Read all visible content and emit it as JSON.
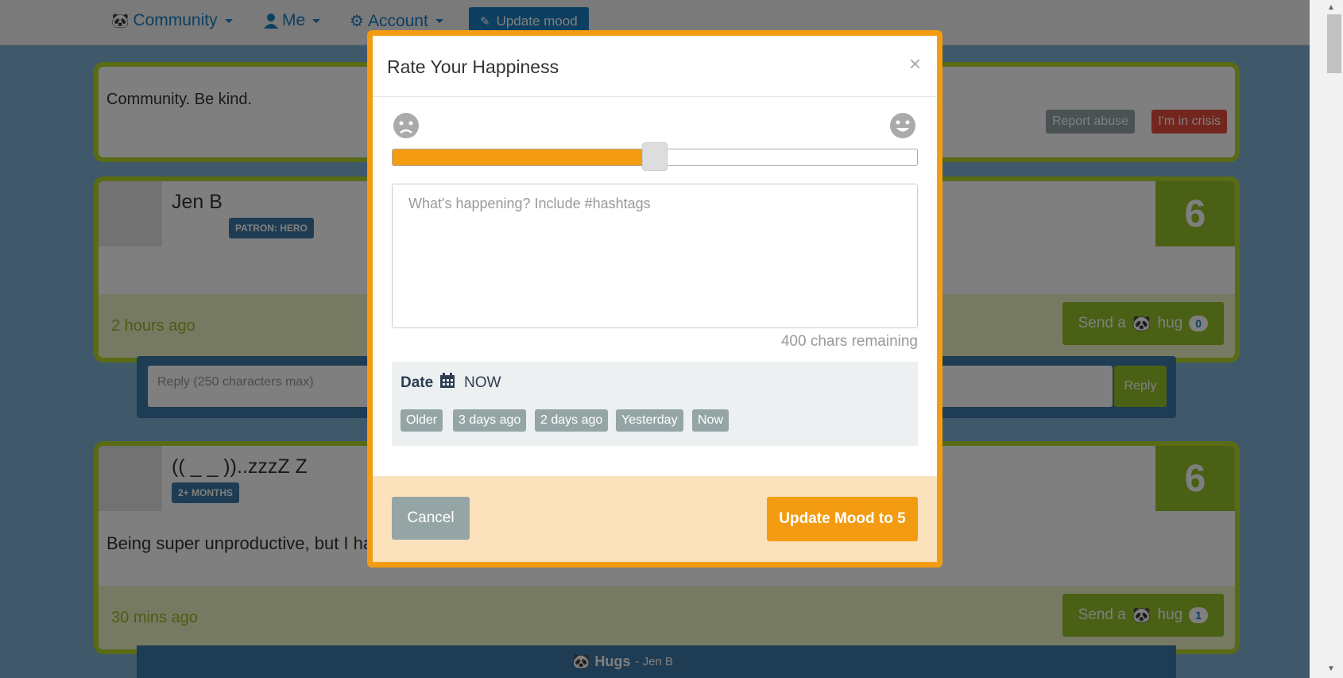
{
  "navbar": {
    "community_label": "Community",
    "me_label": "Me",
    "account_label": "Account",
    "update_mood_label": "Update mood"
  },
  "page": {
    "notice_text": "Community. Be kind.",
    "report_abuse_label": "Report abuse",
    "crisis_label": "I'm in crisis",
    "reply_placeholder": "Reply (250 characters max)",
    "reply_button_label": "Reply",
    "posts": [
      {
        "username": "Jen B",
        "badges": [
          "PATRON: HERO"
        ],
        "score": "6",
        "time": "2 hours ago",
        "hug_label": "Send a",
        "hug_suffix": "hug",
        "hug_count": "0"
      },
      {
        "username": "(( _ _ ))..zzzZ Z",
        "badges": [
          "2+ MONTHS"
        ],
        "score": "6",
        "body": "Being super unproductive, but I ha",
        "time": "30 mins ago",
        "hug_label": "Send a",
        "hug_suffix": "hug",
        "hug_count": "1"
      }
    ],
    "hugs_footer": {
      "label": "Hugs",
      "from": "- Jen B"
    }
  },
  "modal": {
    "title": "Rate Your Happiness",
    "close_symbol": "×",
    "mood_level": 0.5,
    "textarea_placeholder": "What's happening? Include #hashtags",
    "chars_remaining": "400 chars remaining",
    "date_label": "Date",
    "date_value": "NOW",
    "date_chips": [
      "Older",
      "3 days ago",
      "2 days ago",
      "Yesterday",
      "Now"
    ],
    "cancel_label": "Cancel",
    "update_label": "Update Mood to 5"
  },
  "colors": {
    "accent_orange": "#f39c12",
    "brand_green": "#94c12a",
    "brand_blue": "#1a7fc1",
    "danger_red": "#e74c3c",
    "muted_gray": "#95a5a6"
  },
  "icons": {
    "sad_face": "sad-face-icon",
    "happy_face": "happy-face-icon",
    "calendar": "calendar-icon",
    "panda": "panda-icon",
    "user": "user-icon",
    "gear": "gear-icon",
    "edit": "edit-icon"
  }
}
